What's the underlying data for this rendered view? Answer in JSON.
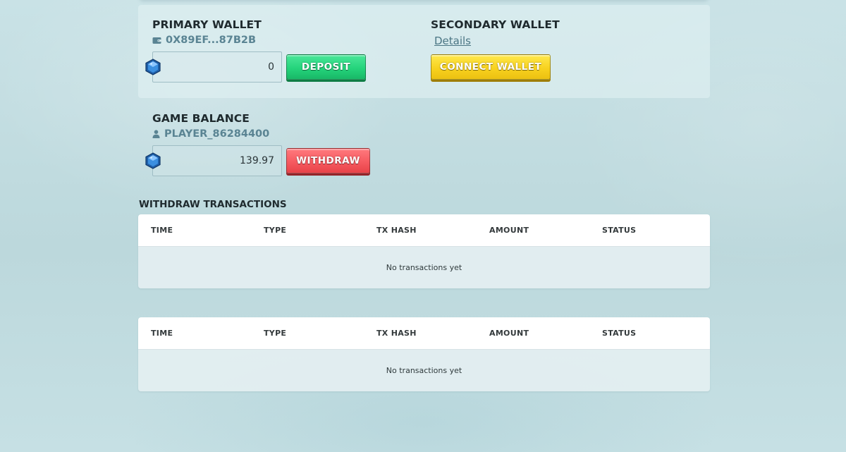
{
  "primary_wallet": {
    "title": "PRIMARY WALLET",
    "address": "0X89EF...87B2B",
    "amount": "0",
    "button_label": "DEPOSIT"
  },
  "secondary_wallet": {
    "title": "SECONDARY WALLET",
    "details_link": "Details",
    "button_label": "CONNECT WALLET"
  },
  "game_balance": {
    "title": "GAME BALANCE",
    "player": "PLAYER_86284400",
    "amount": "139.97",
    "button_label": "WITHDRAW"
  },
  "withdraw_section": {
    "title": "WITHDRAW TRANSACTIONS"
  },
  "tables": [
    {
      "columns": [
        "TIME",
        "TYPE",
        "TX HASH",
        "AMOUNT",
        "STATUS"
      ],
      "empty_message": "No transactions yet"
    },
    {
      "columns": [
        "TIME",
        "TYPE",
        "TX HASH",
        "AMOUNT",
        "STATUS"
      ],
      "empty_message": "No transactions yet"
    }
  ],
  "icons": {
    "wallet": "wallet-icon",
    "user": "user-icon",
    "gem": "gem-icon"
  },
  "colors": {
    "deposit": "#25d47c",
    "connect": "#f8d21f",
    "withdraw": "#f65a60",
    "accent_text": "#5a8493"
  }
}
